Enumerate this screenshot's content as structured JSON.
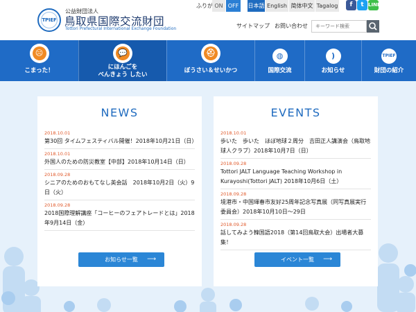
{
  "header": {
    "org_sub": "公益財団法人",
    "org_name": "鳥取県国際交流財団",
    "org_en": "Tottori Prefectural International Exchange Foundation",
    "logo_text": "TPIEF",
    "furigana_label": "ふりがな",
    "furigana_on": "ON",
    "furigana_off": "OFF",
    "languages": [
      "日本語",
      "English",
      "简体中文",
      "Tagalog"
    ],
    "sns": [
      "f",
      "t",
      "LINE"
    ],
    "sitemap": "サイトマップ",
    "contact": "お問い合わせ",
    "search_placeholder": "キーワード検索"
  },
  "nav": {
    "items": [
      {
        "label": "こまった！"
      },
      {
        "label_line1": "にほんごを",
        "label_line2": "べんきょう したい"
      },
      {
        "label": "ぼうさい＆せいかつ"
      },
      {
        "label": "国際交流"
      },
      {
        "label": "お知らせ"
      },
      {
        "label": "財団の紹介"
      }
    ]
  },
  "news": {
    "title": "NEWS",
    "items": [
      {
        "date": "2018.10.01",
        "text": "第30回 タイムフェスティバル開催！2018年10月21日（日）"
      },
      {
        "date": "2018.10.01",
        "text": "外国人のための防災教室【中部】2018年10月14日（日）"
      },
      {
        "date": "2018.09.28",
        "text": "シニアのためのおもてなし英会話　2018年10月2日（火）9日（火）"
      },
      {
        "date": "2018.09.28",
        "text": "2018国際理解講座「コーヒーのフェアトレードとは」2018年9月14日（金）"
      }
    ],
    "more_button": "お知らせ一覧"
  },
  "events": {
    "title": "EVENTS",
    "items": [
      {
        "date": "2018.10.01",
        "text": "歩いた　歩いた　ほぼ地球２周分　吉田正人講演会（鳥取地球人クラブ）2018年10月7日（日）"
      },
      {
        "date": "2018.09.28",
        "text": "Tottori JALT Language Teaching Workshop in Kurayoshi(Tottori JALT) 2018年10月6日（土）"
      },
      {
        "date": "2018.09.28",
        "text": "境港市・中国琿春市友好25周年記念写真展（同写真展実行委員会）2018年10月10日〜29日"
      },
      {
        "date": "2018.09.28",
        "text": "話してみよう韓国語2018（第14回鳥取大会）出場者大募集！"
      }
    ],
    "more_button": "イベント一覧"
  },
  "colors": {
    "brand_blue": "#1f6bc6",
    "date_orange": "#e0592a",
    "accent_orange": "#f08a24",
    "button_blue": "#2b86d6"
  }
}
